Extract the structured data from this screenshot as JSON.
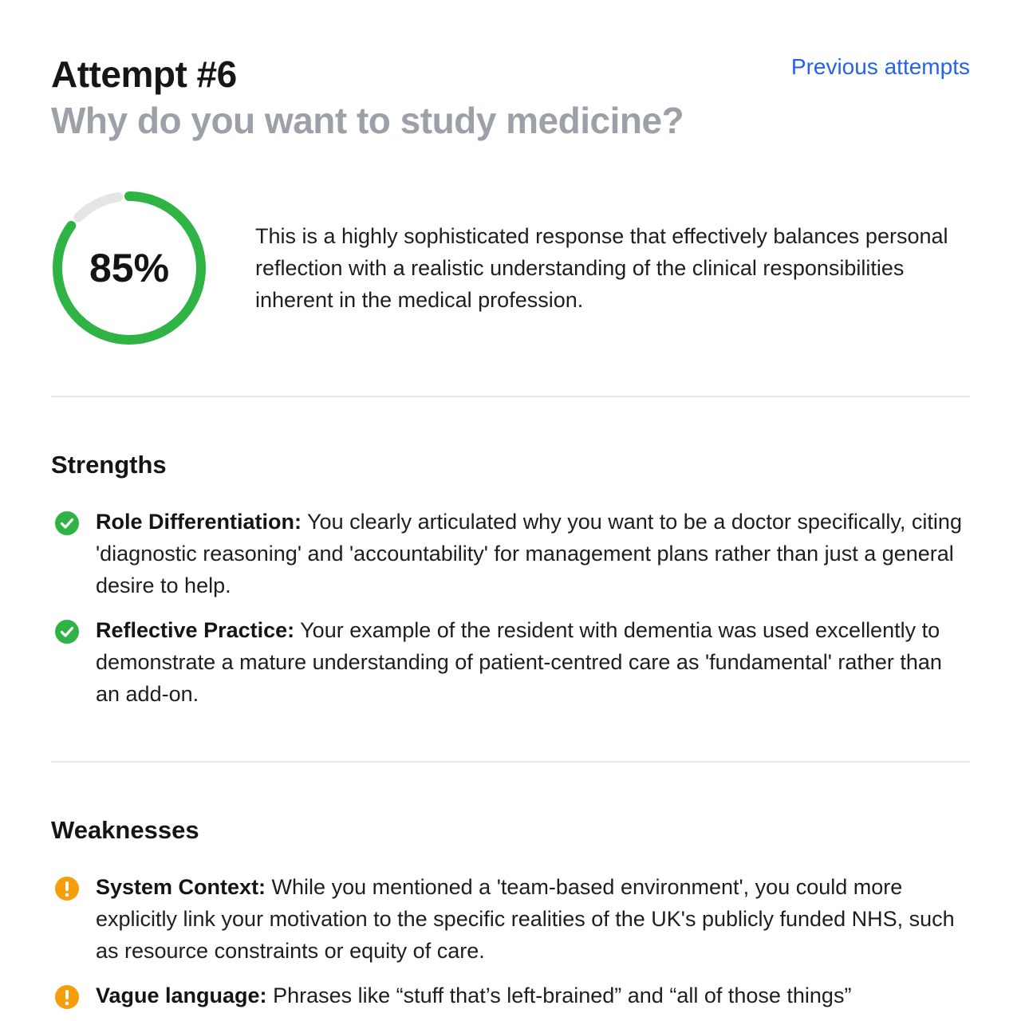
{
  "header": {
    "attempt_title": "Attempt #6",
    "question": "Why do you want to study medicine?",
    "previous_attempts_label": "Previous attempts"
  },
  "score": {
    "value": 85,
    "label": "85%",
    "color": "#2fb344",
    "track_color": "#e5e5e5"
  },
  "summary": "This is a highly sophisticated response that effectively balances personal reflection with a realistic understanding of the clinical responsibilities inherent in the medical profession.",
  "strengths": {
    "heading": "Strengths",
    "icon": "check-circle-icon",
    "color": "#2fb344",
    "items": [
      {
        "title": "Role Differentiation:",
        "body": " You clearly articulated why you want to be a doctor specifically, citing 'diagnostic reasoning' and 'accountability' for management plans rather than just a general desire to help."
      },
      {
        "title": "Reflective Practice:",
        "body": " Your example of the resident with dementia was used excellently to demonstrate a mature understanding of patient-centred care as 'fundamental' rather than an add-on."
      }
    ]
  },
  "weaknesses": {
    "heading": "Weaknesses",
    "icon": "exclamation-circle-icon",
    "color": "#f59e0b",
    "items": [
      {
        "title": "System Context:",
        "body": " While you mentioned a 'team-based environment', you could more explicitly link your motivation to the specific realities of the UK's publicly funded NHS, such as resource constraints or equity of care."
      },
      {
        "title": "Vague language:",
        "body": " Phrases like “stuff that’s left-brained” and “all of those things”"
      }
    ]
  }
}
